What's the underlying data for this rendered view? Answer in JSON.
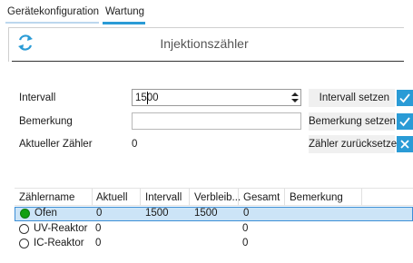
{
  "tabs": [
    {
      "label": "Gerätekonfiguration"
    },
    {
      "label": "Wartung"
    }
  ],
  "panel": {
    "title": "Injektionszähler",
    "refresh_icon": "refresh-icon"
  },
  "form": {
    "interval": {
      "label": "Intervall",
      "value": "1500",
      "button": "Intervall setzen",
      "button_icon": "check-icon"
    },
    "remark": {
      "label": "Bemerkung",
      "value": "",
      "button": "Bemerkung setzen",
      "button_icon": "check-icon"
    },
    "counter": {
      "label": "Aktueller Zähler",
      "value": "0",
      "button": "Zähler zurücksetzen",
      "button_icon": "close-icon"
    }
  },
  "table": {
    "columns": [
      "Zählername",
      "Aktuell",
      "Intervall",
      "Verbleib...",
      "Gesamt",
      "Bemerkung"
    ],
    "rows": [
      {
        "name": "Ofen",
        "aktuell": "0",
        "intervall": "1500",
        "verbleibend": "1500",
        "gesamt": "0",
        "bemerkung": "",
        "selected": true,
        "status": "active"
      },
      {
        "name": "UV-Reaktor",
        "aktuell": "0",
        "intervall": "",
        "verbleibend": "",
        "gesamt": "0",
        "bemerkung": "",
        "selected": false,
        "status": "inactive"
      },
      {
        "name": "IC-Reaktor",
        "aktuell": "0",
        "intervall": "",
        "verbleibend": "",
        "gesamt": "0",
        "bemerkung": "",
        "selected": false,
        "status": "inactive"
      }
    ]
  },
  "colors": {
    "accent": "#2a9bd6",
    "selection": "#cce4f7",
    "status_active": "#12a012"
  }
}
